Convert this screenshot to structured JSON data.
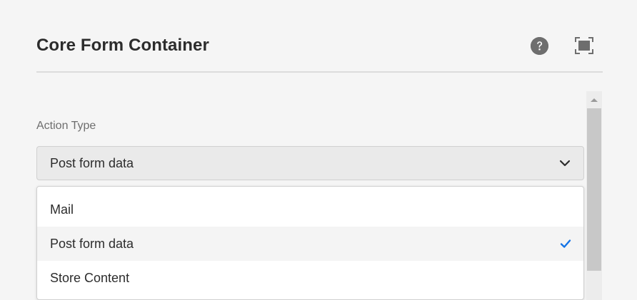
{
  "dialog": {
    "title": "Core Form Container",
    "help_icon": "help-icon",
    "fullscreen_icon": "fullscreen-icon"
  },
  "field": {
    "label": "Action Type",
    "selected_value": "Post form data",
    "chevron_icon": "chevron-down-icon"
  },
  "dropdown": {
    "options": [
      {
        "label": "Mail",
        "selected": false
      },
      {
        "label": "Post form data",
        "selected": true
      },
      {
        "label": "Store Content",
        "selected": false
      }
    ],
    "check_icon": "checkmark-icon",
    "check_color": "#1473e6"
  },
  "colors": {
    "background": "#f5f5f5",
    "title": "#2c2c2c",
    "label": "#6e6e6e",
    "icon": "#6e6e6e",
    "accent": "#1473e6"
  }
}
